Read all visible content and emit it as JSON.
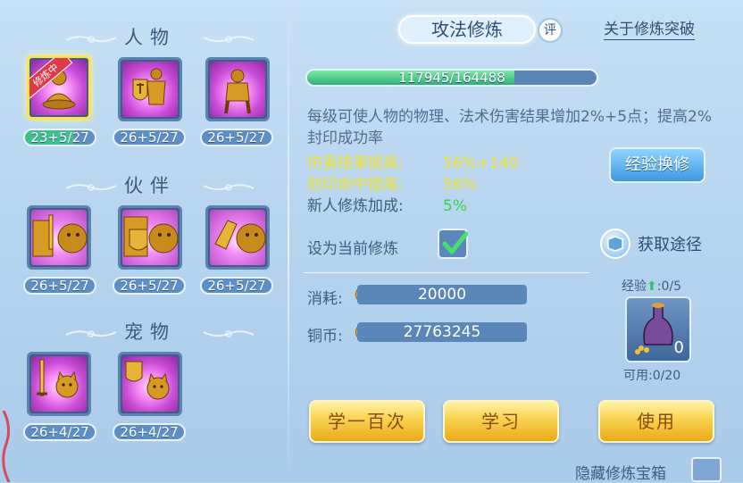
{
  "header": {
    "title": "攻法修炼",
    "ping_label": "评",
    "about_link": "关于修炼突破"
  },
  "left": {
    "sections": [
      {
        "title": "人物"
      },
      {
        "title": "伙伴"
      },
      {
        "title": "宠物"
      }
    ],
    "character": [
      {
        "level": "23+5/27",
        "active": true,
        "ribbon": "修炼中",
        "icon": "monk-meditating-icon"
      },
      {
        "level": "26+5/27",
        "icon": "warrior-shield-icon"
      },
      {
        "level": "26+5/27",
        "icon": "monk-standing-icon"
      }
    ],
    "partner": [
      {
        "level": "26+5/27",
        "icon": "partner-sword-lion-icon"
      },
      {
        "level": "26+5/27",
        "icon": "partner-shield-lion-icon"
      },
      {
        "level": "26+5/27",
        "icon": "partner-gauntlet-lion-icon"
      }
    ],
    "pet": [
      {
        "level": "26+4/27",
        "icon": "pet-sword-cat-icon"
      },
      {
        "level": "26+4/27",
        "icon": "pet-shield-cat-icon"
      }
    ]
  },
  "progress": {
    "text": "117945/164488",
    "fraction": 0.717
  },
  "description": "每级可使人物的物理、法术伤害结果增加2%+5点；提高2%封印成功率",
  "stats": [
    {
      "label": "伤害结果提高:",
      "value": "56%+140",
      "style": "yellow"
    },
    {
      "label": "封印命中提高:",
      "value": "56%",
      "style": "yellow"
    },
    {
      "label": "新人修炼加成:",
      "value": "5%",
      "style": "grey-green"
    }
  ],
  "buttons": {
    "exchange": "经验换修",
    "get_way": "获取途径",
    "learn_hundred": "学一百次",
    "learn": "学习",
    "use": "使用"
  },
  "set_current_label": "设为当前修炼",
  "cost": {
    "consume_label": "消耗:",
    "consume_value": "20000",
    "coin_label": "铜币:",
    "coin_value": "27763245"
  },
  "item": {
    "exp_label": "经验",
    "exp_value": ":0/5",
    "count": "0",
    "usable": "可用:0/20",
    "icon": "bottle-icon"
  },
  "hide_box_label": "隐藏修炼宝箱",
  "colors": {
    "yellow_text": "#f3e22d",
    "green_text": "#33d34a",
    "accent_blue": "#3f98e0"
  }
}
